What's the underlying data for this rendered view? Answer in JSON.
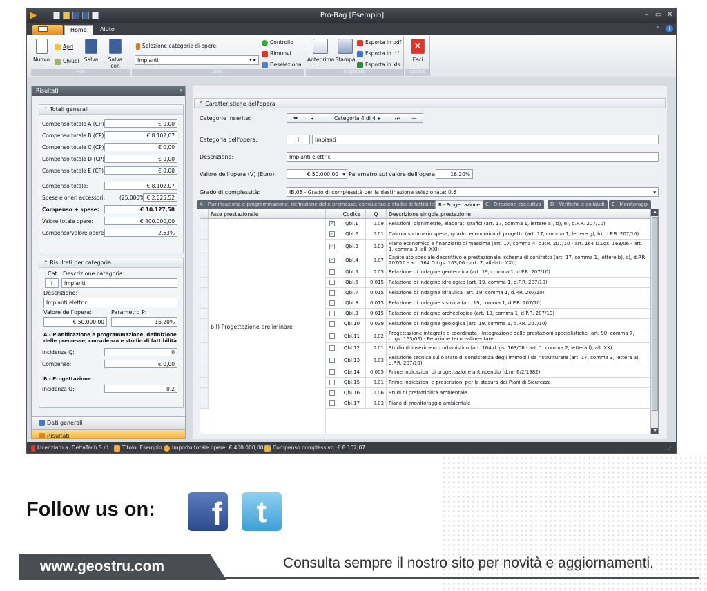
{
  "window": {
    "title": "Pro-Bag [Esempio]"
  },
  "ribbon": {
    "tabs": [
      "Home",
      "Aiuto"
    ],
    "groups": {
      "file": {
        "label": "File",
        "nuovo": "Nuovo",
        "apri": "Apri",
        "chiudi": "Chiudi",
        "salva": "Salva",
        "salva_con_nome_1": "Salva",
        "salva_con_nome_2": "con nome"
      },
      "dati": {
        "label": "Dati",
        "selezione_label": "Selezione categorie di opere:",
        "selezione_value": "Impianti",
        "controllo": "Controllo",
        "rimuovi": "Rimuovi",
        "deseleziona": "Deseleziona"
      },
      "rapporto": {
        "label": "Rapporto",
        "anteprima": "Anteprima",
        "stampa": "Stampa",
        "pdf": "Esporta in pdf",
        "rtf": "Esporta in rtf",
        "xls": "Esporta in xls"
      },
      "uscita": {
        "label": "Uscita",
        "esci": "Esci"
      }
    }
  },
  "left": {
    "title": "Risultati",
    "totali": {
      "header": "Totali generali",
      "rows": [
        {
          "label": "Compenso totale A  (CP):",
          "value": "€ 0,00"
        },
        {
          "label": "Compenso totale B  (CP):",
          "value": "€ 8.102,07"
        },
        {
          "label": "Compenso totale C  (CP):",
          "value": "€ 0,00"
        },
        {
          "label": "Compenso totale D  (CP):",
          "value": "€ 0,00"
        },
        {
          "label": "Compenso totale E  (CP):",
          "value": "€ 0,00"
        }
      ],
      "compenso_totale_label": "Compenso totale:",
      "compenso_totale": "€ 8.102,07",
      "spese_label": "Spese e oneri accessori:",
      "spese_pct": "(25.000%)",
      "spese_value": "€ 2.025,52",
      "compenso_spese_label": "Compenso + spese:",
      "compenso_spese": "€ 10.127,58",
      "valore_totale_label": "Valore totale opere:",
      "valore_totale": "€ 400.000,00",
      "rapporto_label": "Compenso/valore opere:",
      "rapporto": "2.53%"
    },
    "per_categoria": {
      "header": "Risultati per categoria",
      "cat_label": "Cat.",
      "desc_cat_label": "Descrizione categoria:",
      "cat": "I",
      "desc_cat": "Impianti",
      "descrizione_label": "Descrizione:",
      "descrizione": "Impianti elettrici",
      "valore_label": "Valore dell'opera:",
      "param_label": "Parametro P:",
      "valore": "€ 50.000,00",
      "param": "16.20%",
      "sezA_title_1": "A - Pianificazione e programmazione, definizione",
      "sezA_title_2": "delle premesse, consulenza e studio di fattibilità",
      "incidenza_label": "Incidenza Q:",
      "incidenzaA": "0",
      "compenso_label": "Compenso:",
      "compensoA": "€ 0,00",
      "sezB_title": "B - Progettazione",
      "incidenzaB": "0.2"
    },
    "nav": {
      "dati_generali": "Dati generali",
      "risultati": "Risultati"
    }
  },
  "main": {
    "section_title": "Caratteristiche dell'opera",
    "categorie_label": "Categorie inserite:",
    "categoria_nav": "Categoria 4 di 4",
    "categoria_label": "Categoria dell'opera:",
    "cat_code": "I",
    "cat_name": "Impianti",
    "descrizione_label": "Descrizione:",
    "descrizione": "Impianti elettrici",
    "valore_label": "Valore dell'opera (V) (Euro):",
    "valore": "€ 50.000,00",
    "parametro_label": "Parametro sul valore dell'opera (P):",
    "parametro": "16.20%",
    "grado_label": "Grado di complessità:",
    "grado": "IB.08 - Grado di complessità per la destinazione selezionata: 0.6",
    "tabs": [
      "A - Pianificazione e programmazione, definizione delle premesse, consulenza e studio di fattibilità",
      "B - Progettazione",
      "C - Direzione esecutiva",
      "D - Verifiche e collaudi",
      "E - Monitoraggi"
    ],
    "grid": {
      "headers": {
        "fase": "Fase prestazionale",
        "codice": "Codice",
        "q": "Q",
        "descrizione": "Descrizione singola prestazione"
      },
      "fase_value": "b.I) Progettazione preliminare",
      "rows": [
        {
          "checked": true,
          "codice": "QbI.1",
          "q": "0.09",
          "desc": "Relazioni, planimetrie, elaborati grafici (art. 17, comma 1, lettere a), b), e), d.P.R. 207/10)"
        },
        {
          "checked": true,
          "codice": "QbI.2",
          "q": "0.01",
          "desc": "Calcolo sommario spesa, quadro economico di progetto (art. 17, comma 1, lettere g), h), d.P.R. 207/10)"
        },
        {
          "checked": true,
          "codice": "QbI.3",
          "q": "0.03",
          "desc": "Piano economico e finanziario di massima (art. 17, comma 4, d.P.R. 207/10 - art. 164 D.Lgs. 163/06 - art. 1, comma 3, all. XXI))"
        },
        {
          "checked": true,
          "codice": "QbI.4",
          "q": "0.07",
          "desc": "Capitolato speciale descrittivo e prestazionale, schema di contratto (art. 17, comma 1, lettere b), c), d.P.R. 207/10 - art. 164 D.Lgs. 163/06 - art. 7, allelato XXI))"
        },
        {
          "checked": false,
          "codice": "QbI.5",
          "q": "0.03",
          "desc": "Relazione di indagine geotecnica (art. 19, comma 1, d.P.R. 207/10)"
        },
        {
          "checked": false,
          "codice": "QbI.6",
          "q": "0.015",
          "desc": "Relazione di indagine idrologica (art. 19, comma 1, d.P.R. 207/10)"
        },
        {
          "checked": false,
          "codice": "QbI.7",
          "q": "0.015",
          "desc": "Relazione di indagine idraulica (art. 19, comma 1, d.P.R. 207/10)"
        },
        {
          "checked": false,
          "codice": "QbI.8",
          "q": "0.015",
          "desc": "Relazione di indagine sismica (art. 19, comma 1, d.P.R. 207/10)"
        },
        {
          "checked": false,
          "codice": "QbI.9",
          "q": "0.015",
          "desc": "Relazione di indagine archeologica (art. 19, comma 1, d.P.R. 207/10)"
        },
        {
          "checked": false,
          "codice": "QbI.10",
          "q": "0.039",
          "desc": "Relazione di indagine geologica (art. 19, comma 1, d.P.R. 207/10)"
        },
        {
          "checked": false,
          "codice": "QbI.11",
          "q": "0.02",
          "desc": "Progettazione integrale e coordinata - Integrazione delle prestazioni specialistiche (art. 90, comma 7, d.lgs. 163/06) - Relazione tecno-alimentare"
        },
        {
          "checked": false,
          "codice": "QbI.12",
          "q": "0.01",
          "desc": "Studio di inserimento urbanistico (art. 164 d.lgs. 163/06 - art. 1, comma 2, lettera l), all. XX)"
        },
        {
          "checked": false,
          "codice": "QbI.13",
          "q": "0.03",
          "desc": "Relazione tecnica sullo stato di consistenza degli immobili da ristrutturare (art. 17, comma 3, lettera a), d.P.R. 207/10)"
        },
        {
          "checked": false,
          "codice": "QbI.14",
          "q": "0.005",
          "desc": "Prime indicazioni di progettazione antincendio (d.m. 6/2/1982)"
        },
        {
          "checked": false,
          "codice": "QbI.15",
          "q": "0.01",
          "desc": "Prime indicazioni e prescrizioni per la stesura dei Piani di Sicurezza"
        },
        {
          "checked": false,
          "codice": "QbI.16",
          "q": "0.06",
          "desc": "Studi di prefattibilità ambientale"
        },
        {
          "checked": false,
          "codice": "QbI.17",
          "q": "0.03",
          "desc": "Piano di monitoraggio ambientale"
        }
      ]
    }
  },
  "status": {
    "licenza": "Licenziato a: DeltaTech S.r.l.",
    "titolo": "Titolo: Esempio",
    "importo": "Importo totale opere: € 400.000,00",
    "compenso": "Compenso complessivo: € 8.102,07"
  },
  "footer": {
    "follow": "Follow us on:",
    "website": "www.geostru.com",
    "tagline": "Consulta sempre il nostro sito per novità e aggiornamenti.",
    "colors": {
      "facebook": "#3b5998",
      "twitter": "#4aa8d8",
      "bar": "#4a4d52"
    }
  }
}
